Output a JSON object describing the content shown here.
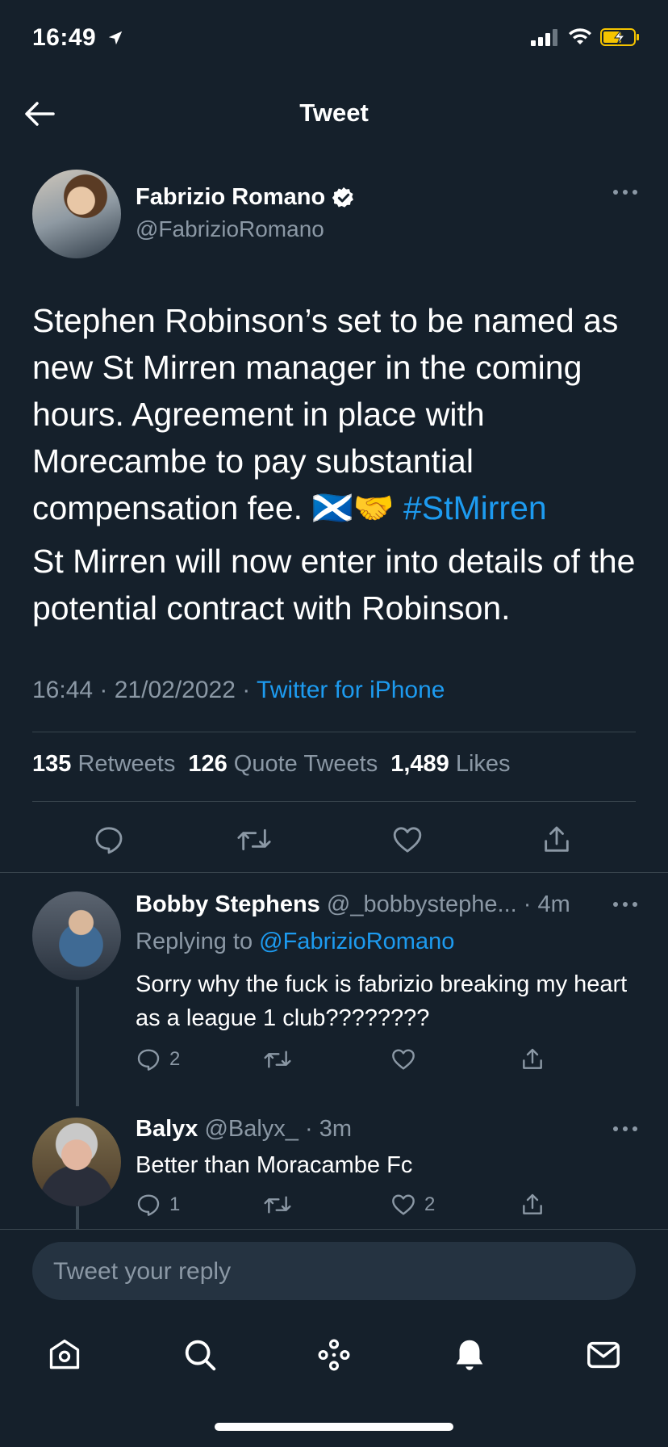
{
  "status_bar": {
    "time": "16:49"
  },
  "header": {
    "title": "Tweet"
  },
  "tweet": {
    "author_name": "Fabrizio Romano",
    "author_handle": "@FabrizioRomano",
    "paragraph1": "Stephen Robinson’s set to be named as new St Mirren manager in the coming hours. Agreement in place with Morecambe to pay substantial compensation fee.",
    "emojis": "🏴󠁧󠁢󠁳󠁣󠁴󠁿🤝",
    "hashtag": "#StMirren",
    "paragraph2": "St Mirren will now enter into details of the potential contract with Robinson.",
    "time": "16:44",
    "date": "21/02/2022",
    "source": "Twitter for iPhone",
    "retweets_count": "135",
    "retweets_label": "Retweets",
    "quotes_count": "126",
    "quotes_label": "Quote Tweets",
    "likes_count": "1,489",
    "likes_label": "Likes"
  },
  "replies": [
    {
      "name": "Bobby Stephens",
      "handle": "@_bobbystephe...",
      "age": "4m",
      "replying_to_label": "Replying to",
      "replying_to_handle": "@FabrizioRomano",
      "text": "Sorry why the fuck is fabrizio breaking my heart as a league 1 club????????",
      "reply_count": "2",
      "retweet_count": "",
      "like_count": ""
    },
    {
      "name": "Balyx",
      "handle": "@Balyx_",
      "age": "3m",
      "text": "Better than Moracambe Fc",
      "reply_count": "1",
      "retweet_count": "",
      "like_count": "2"
    }
  ],
  "composer": {
    "placeholder": "Tweet your reply"
  },
  "tab_bar": [
    "home-icon",
    "search-icon",
    "spaces-icon",
    "notifications-icon",
    "messages-icon"
  ],
  "colors": {
    "background": "#15202b",
    "accent": "#1d9bf0",
    "muted": "#8b98a5",
    "divider": "#38444d"
  }
}
